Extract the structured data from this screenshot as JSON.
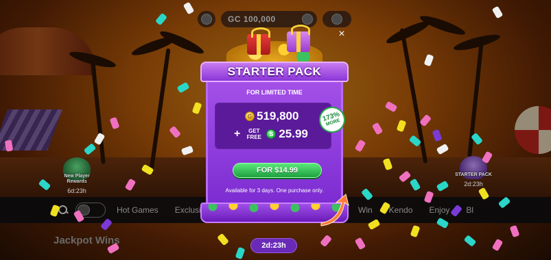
{
  "topbar": {
    "gc_balance": "GC 100,000"
  },
  "badges": {
    "left": {
      "title": "New Player Rewards",
      "time": "6d:23h"
    },
    "right": {
      "title": "STARTER PACK",
      "time": "2d:23h"
    }
  },
  "nav": {
    "items_left": [
      "Hot Games",
      "Exclusiv"
    ],
    "items_right": [
      "Win",
      "Kendo",
      "Enjoy",
      "Bl"
    ]
  },
  "section": {
    "title": "Jackpot Wins"
  },
  "modal": {
    "title": "STARTER PACK",
    "limited_label": "FOR LIMITED TIME",
    "gc_icon": "G",
    "gc_amount": "519,800",
    "plus": "+",
    "get_free": "GET FREE",
    "sc_icon": "S",
    "sc_amount": "25.99",
    "more_pct": "173%",
    "more_label": "MORE",
    "buy_label": "FOR $14.99",
    "availability": "Available for 3 days. One purchase only.",
    "close_icon": "×",
    "timer": "2d:23h"
  },
  "colors": {
    "modal_purple": "#8a36d8",
    "buy_green": "#1ea040",
    "badge_green": "#2aa84a"
  }
}
